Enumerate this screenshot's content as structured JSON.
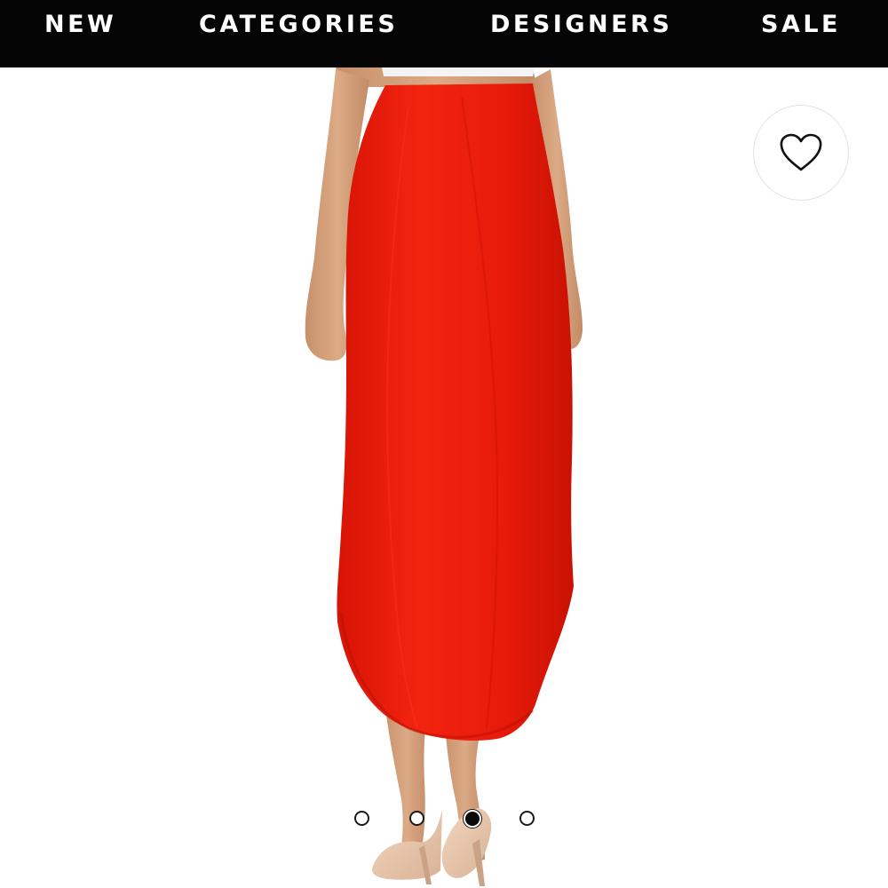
{
  "nav": {
    "items": [
      {
        "label": "NEW"
      },
      {
        "label": "CATEGORIES"
      },
      {
        "label": "DESIGNERS"
      },
      {
        "label": "SALE"
      }
    ],
    "background": "#050505",
    "text_color": "#ffffff"
  },
  "product": {
    "image_subject": "red asymmetric midi skirt, back view",
    "skirt_color": "#ee1c0e",
    "top_color": "#f4f4f4",
    "background_color": "#ffffff"
  },
  "wishlist": {
    "icon": "heart-outline-icon"
  },
  "carousel": {
    "total": 4,
    "active_index": 2
  }
}
